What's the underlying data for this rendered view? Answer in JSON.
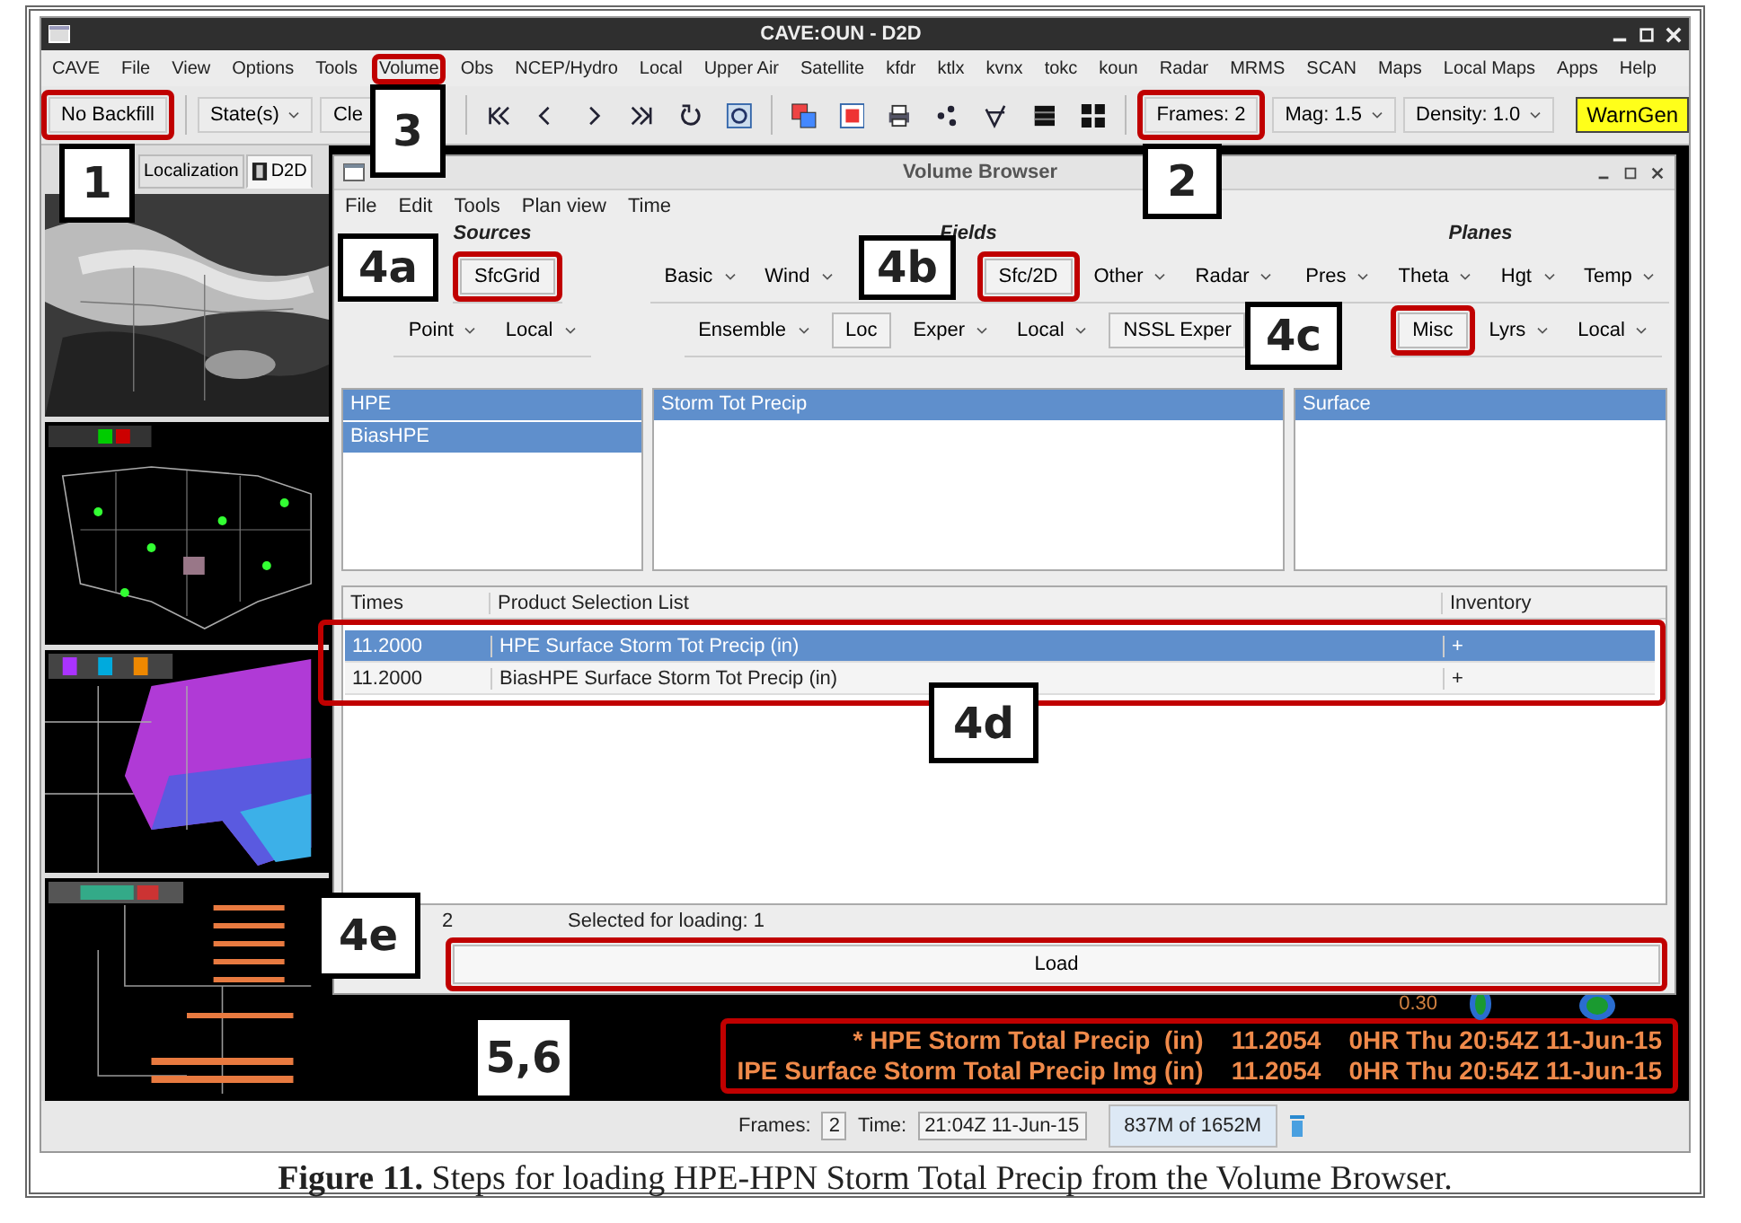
{
  "window": {
    "title": "CAVE:OUN - D2D"
  },
  "menu": [
    {
      "label": "CAVE",
      "highlighted": false
    },
    {
      "label": "File",
      "highlighted": false
    },
    {
      "label": "View",
      "highlighted": false
    },
    {
      "label": "Options",
      "highlighted": false
    },
    {
      "label": "Tools",
      "highlighted": false
    },
    {
      "label": "Volume",
      "highlighted": true
    },
    {
      "label": "Obs",
      "highlighted": false
    },
    {
      "label": "NCEP/Hydro",
      "highlighted": false
    },
    {
      "label": "Local",
      "highlighted": false
    },
    {
      "label": "Upper Air",
      "highlighted": false
    },
    {
      "label": "Satellite",
      "highlighted": false
    },
    {
      "label": "kfdr",
      "highlighted": false
    },
    {
      "label": "ktlx",
      "highlighted": false
    },
    {
      "label": "kvnx",
      "highlighted": false
    },
    {
      "label": "tokc",
      "highlighted": false
    },
    {
      "label": "koun",
      "highlighted": false
    },
    {
      "label": "Radar",
      "highlighted": false
    },
    {
      "label": "MRMS",
      "highlighted": false
    },
    {
      "label": "SCAN",
      "highlighted": false
    },
    {
      "label": "Maps",
      "highlighted": false
    },
    {
      "label": "Local Maps",
      "highlighted": false
    },
    {
      "label": "Apps",
      "highlighted": false
    },
    {
      "label": "Help",
      "highlighted": false
    }
  ],
  "toolbar": {
    "backfill": {
      "label": "No Backfill",
      "highlighted": true
    },
    "state": "State(s)",
    "clear": "Cle",
    "frames": {
      "label": "Frames: 2",
      "highlighted": true
    },
    "mag": "Mag: 1.5",
    "density": "Density: 1.0",
    "warngen": "WarnGen"
  },
  "perspective_tabs": [
    {
      "label": "Localization",
      "selected": false
    },
    {
      "label": "D2D",
      "selected": true
    }
  ],
  "volume_browser": {
    "title": "Volume Browser",
    "menu": [
      "File",
      "Edit",
      "Tools",
      "Plan view",
      "Time"
    ],
    "sections": [
      {
        "heading": "Sources",
        "rows": [
          {
            "buttons": [
              {
                "label": "SfcGrid",
                "dropdown": false,
                "highlighted": true
              }
            ]
          },
          {
            "buttons": [
              {
                "label": "Point",
                "dropdown": true,
                "highlighted": false
              },
              {
                "label": "Local",
                "dropdown": true,
                "highlighted": false
              }
            ]
          }
        ],
        "list": [
          {
            "label": "HPE",
            "selected": true
          },
          {
            "label": "BiasHPE",
            "selected": true
          }
        ]
      },
      {
        "heading": "Fields",
        "rows": [
          {
            "buttons": [
              {
                "label": "Basic",
                "dropdown": true,
                "highlighted": false
              },
              {
                "label": "Wind",
                "dropdown": true,
                "highlighted": false
              },
              {
                "label": "Sfc/2D",
                "dropdown": false,
                "highlighted": true
              },
              {
                "label": "Other",
                "dropdown": true,
                "highlighted": false
              },
              {
                "label": "Radar",
                "dropdown": true,
                "highlighted": false
              }
            ]
          },
          {
            "buttons": [
              {
                "label": "Ensemble",
                "dropdown": true,
                "highlighted": false
              },
              {
                "label": "Loc",
                "dropdown": false,
                "highlighted": false
              },
              {
                "label": "Exper",
                "dropdown": true,
                "highlighted": false
              },
              {
                "label": "Local",
                "dropdown": true,
                "highlighted": false
              },
              {
                "label": "NSSL Exper",
                "dropdown": false,
                "highlighted": false
              }
            ]
          }
        ],
        "list": [
          {
            "label": "Storm Tot Precip",
            "selected": true
          }
        ]
      },
      {
        "heading": "Planes",
        "rows": [
          {
            "buttons": [
              {
                "label": "Pres",
                "dropdown": true,
                "highlighted": false
              },
              {
                "label": "Theta",
                "dropdown": true,
                "highlighted": false
              },
              {
                "label": "Hgt",
                "dropdown": true,
                "highlighted": false
              },
              {
                "label": "Temp",
                "dropdown": true,
                "highlighted": false
              }
            ]
          },
          {
            "buttons": [
              {
                "label": "Misc",
                "dropdown": false,
                "highlighted": true
              },
              {
                "label": "Lyrs",
                "dropdown": true,
                "highlighted": false
              },
              {
                "label": "Local",
                "dropdown": true,
                "highlighted": false
              }
            ]
          }
        ],
        "list": [
          {
            "label": "Surface",
            "selected": true
          }
        ]
      }
    ],
    "table": {
      "columns": [
        "Times",
        "Product Selection List",
        "Inventory"
      ],
      "rows_highlighted": true,
      "rows": [
        {
          "time": "11.2000",
          "product": "HPE Surface Storm Tot Precip (in)",
          "inventory": "+",
          "selected": true
        },
        {
          "time": "11.2000",
          "product": "BiasHPE Surface Storm Tot Precip (in)",
          "inventory": "+",
          "selected": false
        }
      ]
    },
    "available_count": "2",
    "selected_for_loading": "Selected for loading:  1",
    "load_button": {
      "label": "Load",
      "highlighted": true
    }
  },
  "map_contour_label": "0.30",
  "map_legend": {
    "highlighted": true,
    "lines": [
      "* HPE Storm Total Precip  (in)    11.2054    0HR Thu 20:54Z 11-Jun-15",
      "IPE Surface Storm Total Precip Img (in)    11.2054    0HR Thu 20:54Z 11-Jun-15"
    ]
  },
  "status_bar": {
    "frames_label": "Frames:",
    "frames": "2",
    "time_label": "Time:",
    "time": "21:04Z 11-Jun-15",
    "memory": "837M of 1652M"
  },
  "callouts": [
    "1",
    "3",
    "2",
    "4a",
    "4b",
    "4c",
    "4d",
    "4e",
    "5,6"
  ],
  "caption": "**Figure 11.** Steps for loading HPE-HPN Storm Total Precip from the Volume Browser."
}
